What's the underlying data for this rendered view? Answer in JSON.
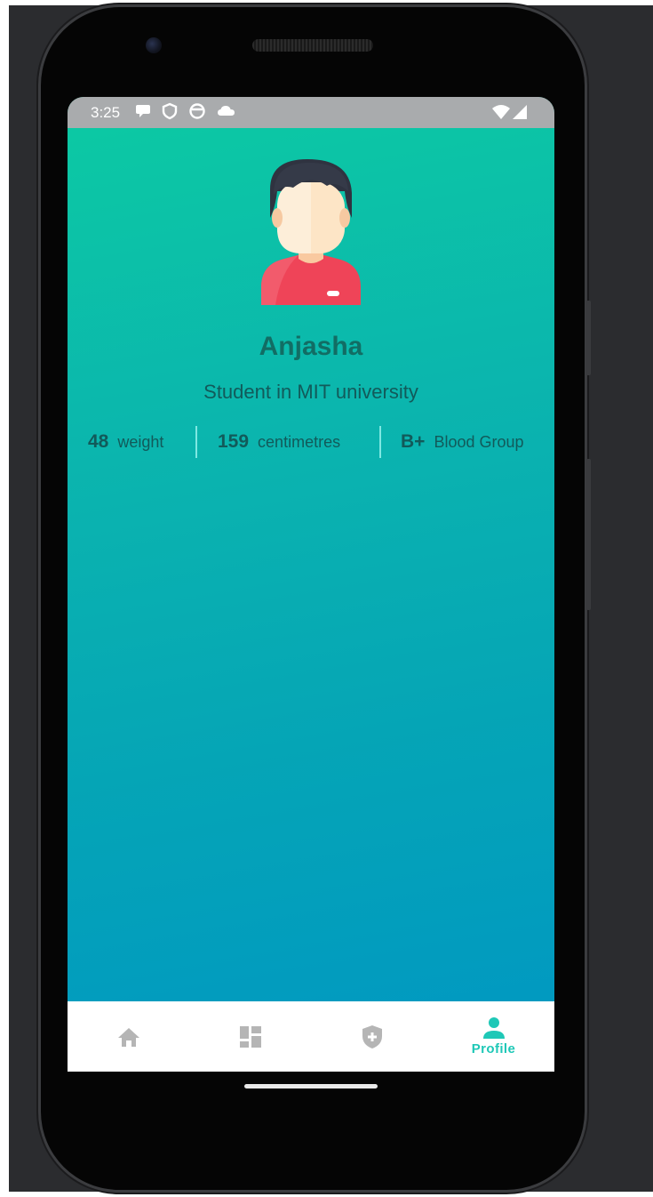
{
  "status_bar": {
    "time": "3:25",
    "left_icons": [
      "chat-bubble-icon",
      "shield-icon",
      "circle-app-icon",
      "cloud-icon"
    ],
    "right_icons": [
      "wifi-icon",
      "cellular-signal-icon"
    ]
  },
  "profile": {
    "avatar_icon": "user-avatar-illustration",
    "name": "Anjasha",
    "subtitle": "Student in MIT university",
    "stats": [
      {
        "value": "48",
        "label": "weight"
      },
      {
        "value": "159",
        "label": "centimetres"
      },
      {
        "value": "B+",
        "label": "Blood Group"
      }
    ]
  },
  "bottom_nav": {
    "items": [
      {
        "icon": "home-icon",
        "label": "",
        "active": false
      },
      {
        "icon": "dashboard-icon",
        "label": "",
        "active": false
      },
      {
        "icon": "health-shield-icon",
        "label": "",
        "active": false
      },
      {
        "icon": "person-icon",
        "label": "Profile",
        "active": true
      }
    ]
  },
  "colors": {
    "gradient_start": "#0ccaa3",
    "gradient_end": "#0097c3",
    "name_text": "#126d64",
    "active_nav": "#1fc8b7",
    "inactive_nav": "#b5b5b5",
    "status_bar_bg": "#a9abad"
  }
}
